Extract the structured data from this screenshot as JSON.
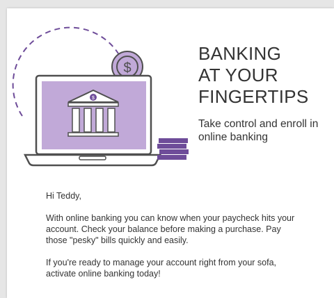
{
  "email": {
    "headline_lines": [
      "BANKING",
      "AT YOUR",
      "FINGERTIPS"
    ],
    "subhead": "Take control and enroll in online banking",
    "greeting": "Hi Teddy,",
    "paragraph_1": "With online banking you can know when your paycheck hits your account. Check your balance before making a purchase. Pay those \"pesky\" bills quickly and easily.",
    "paragraph_2": "If you're ready to manage your account right from your sofa, activate online banking today!"
  },
  "illustration": {
    "coin_symbol": "$",
    "bank_symbol": "$",
    "icons": [
      "laptop-icon",
      "bank-building-icon",
      "dollar-coin-icon",
      "coin-stack-icon"
    ]
  },
  "colors": {
    "accent_purple": "#6e4c99",
    "light_purple": "#c1a9d8",
    "text": "#333333",
    "outline_gray": "#4f4f4f"
  }
}
